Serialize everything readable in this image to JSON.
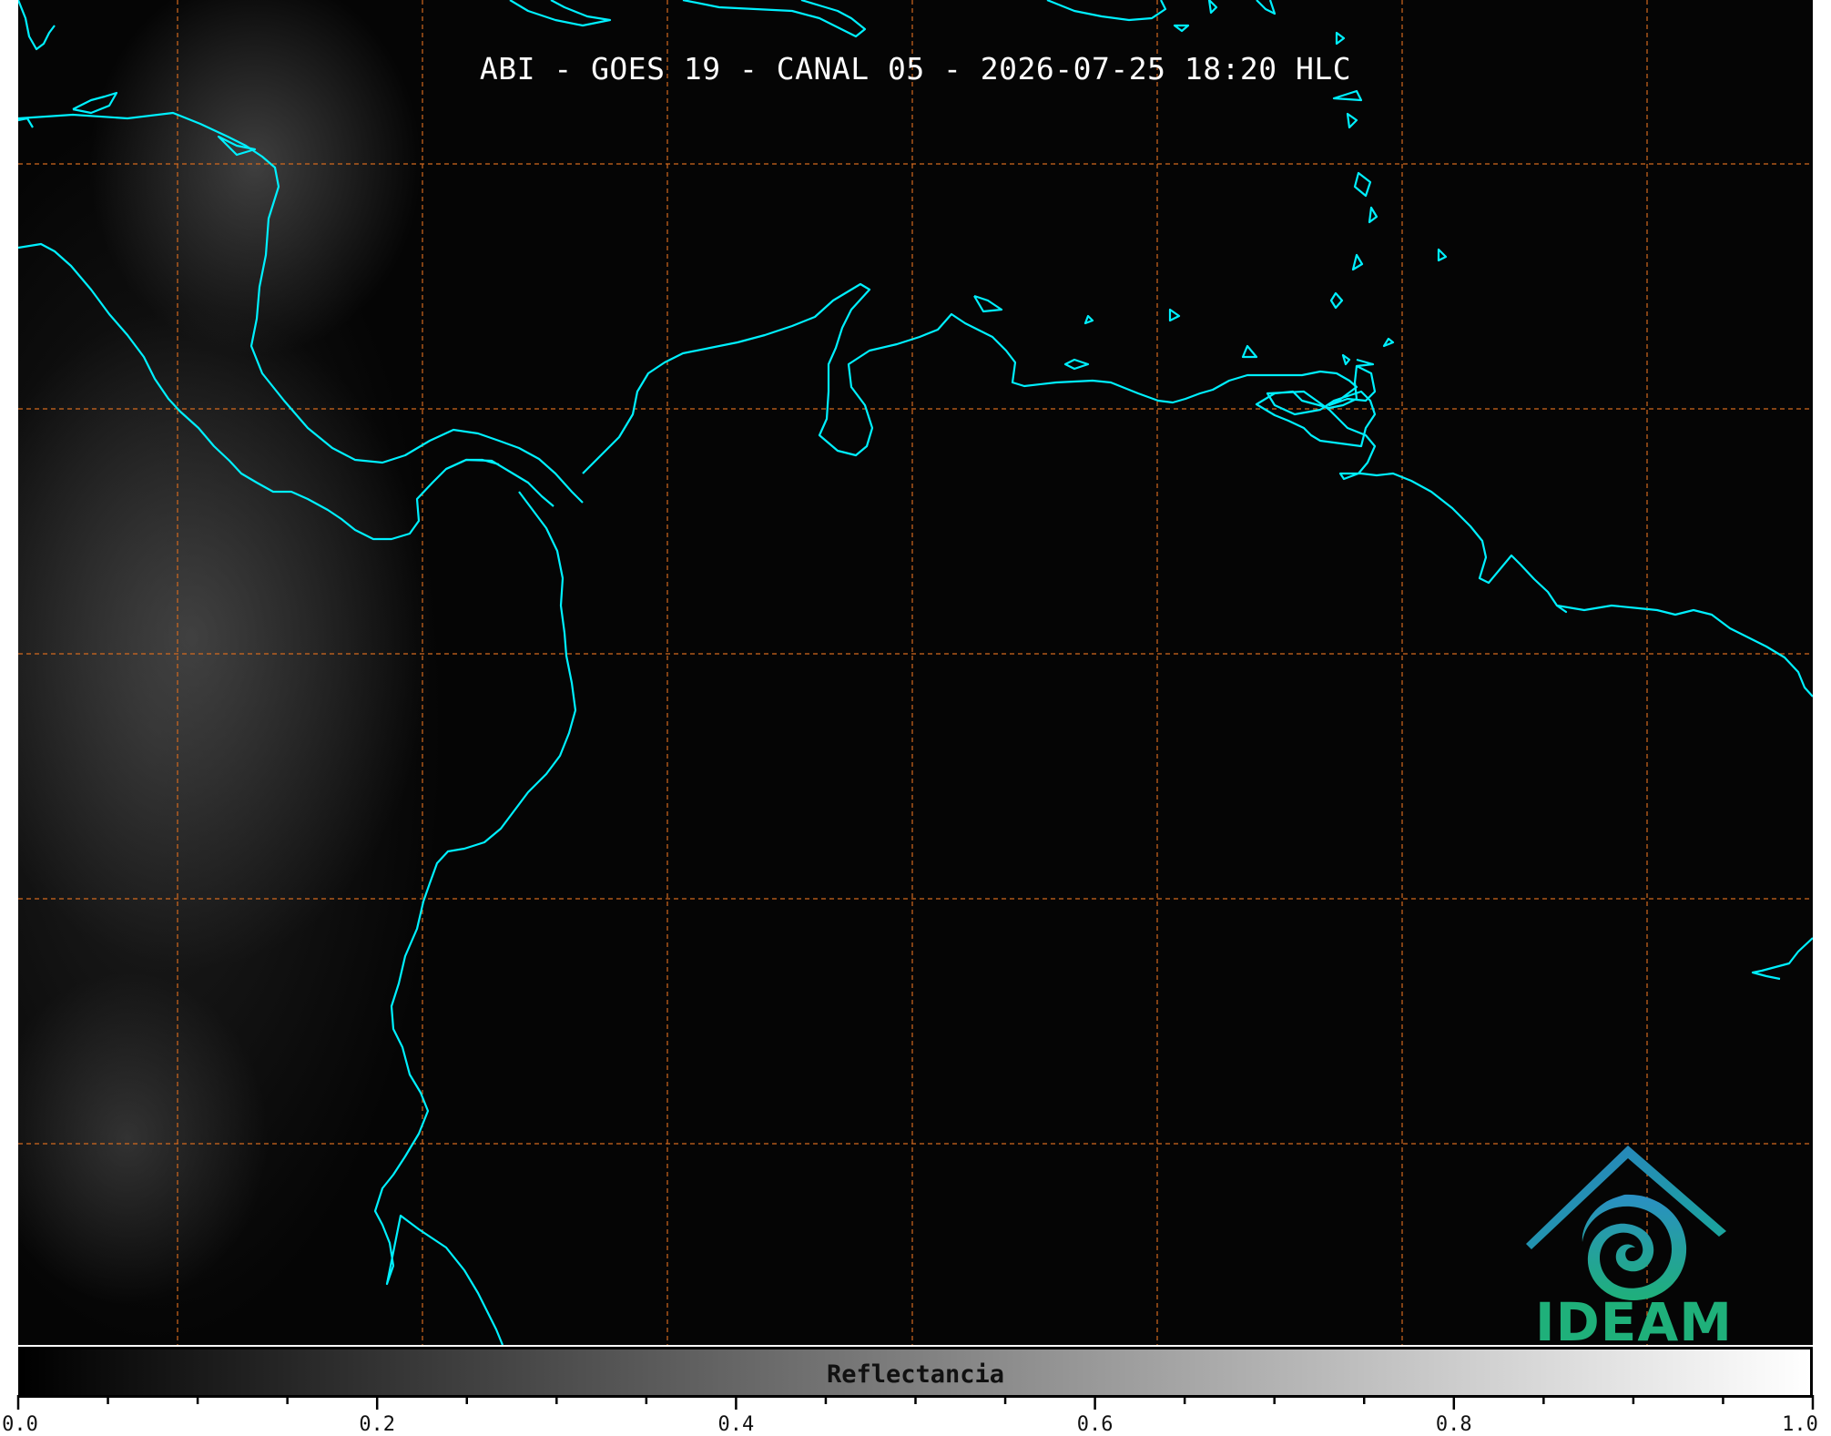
{
  "title": "ABI - GOES 19 - CANAL 05 - 2026-07-25 18:20 HLC",
  "colorbar": {
    "label": "Reflectancia",
    "min": 0.0,
    "max": 1.0,
    "major_ticks": [
      "0.0",
      "0.2",
      "0.4",
      "0.6",
      "0.8",
      "1.0"
    ],
    "colormap": [
      "#000000",
      "#ffffff"
    ]
  },
  "logo": {
    "text": "IDEAM",
    "colors": {
      "roof": "#2a7fc4",
      "swirl": "#1fa89a",
      "text": "#1fb07a"
    }
  },
  "colors": {
    "coastline": "#00f0ff",
    "graticule": "#d2691e",
    "background": "#050505"
  }
}
